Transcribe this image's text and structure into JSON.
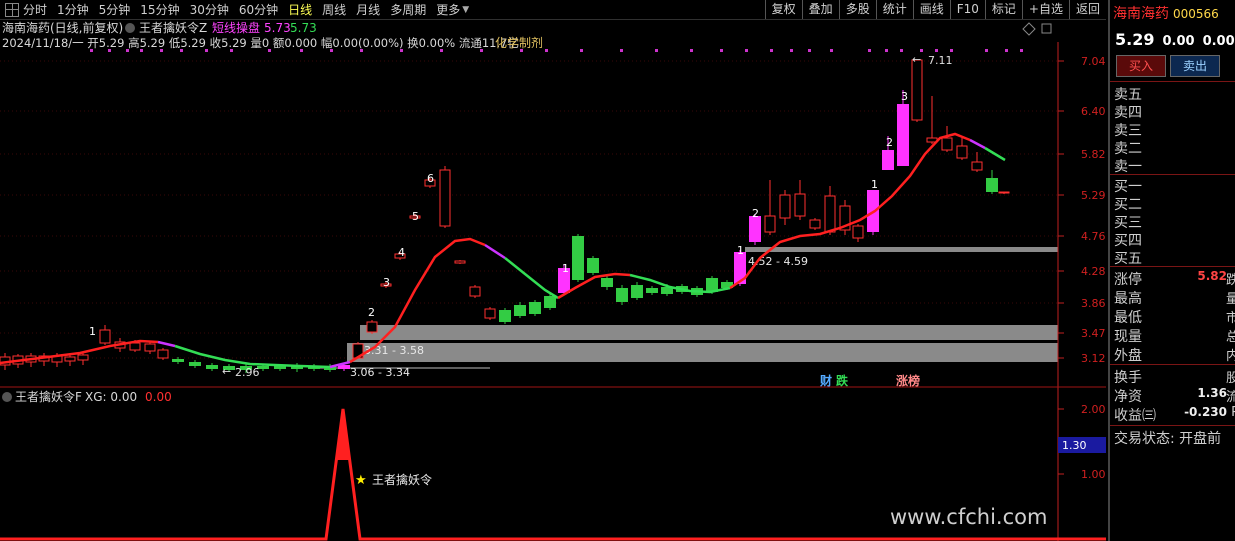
{
  "toolbar": {
    "periods": [
      "分时",
      "1分钟",
      "5分钟",
      "15分钟",
      "30分钟",
      "60分钟",
      "日线",
      "周线",
      "月线",
      "多周期",
      "更多"
    ],
    "active_period": "日线",
    "tools": [
      "复权",
      "叠加",
      "多股",
      "统计",
      "画线",
      "F10",
      "标记",
      "+自选",
      "返回"
    ]
  },
  "chart_header": {
    "stock": "海南海药(日线,前复权)",
    "indicator": "王者擒妖令Z",
    "signal_name": "短线操盘",
    "signal_v1": "5.73",
    "signal_v2": "5.73",
    "quote": "2024/11/18/一 开5.29 高5.29 低5.29 收5.29 量0 额0.000 幅0.00(0.00%) 换0.00% 流通11.7亿",
    "sector": "化学制剂"
  },
  "price_axis": [
    "7.04",
    "6.40",
    "5.82",
    "5.29",
    "4.76",
    "4.28",
    "3.86",
    "3.47",
    "3.12"
  ],
  "zones": [
    {
      "label": "4.52 - 4.59"
    },
    {
      "label": "3.31 - 3.58"
    },
    {
      "label": "3.06 - 3.34"
    }
  ],
  "price_annotations": {
    "high": "7.11",
    "low": "2.96"
  },
  "event_tags": {
    "finance": "财",
    "fall": "跌",
    "surge": "涨榜"
  },
  "sub_chart": {
    "title": "王者擒妖令F",
    "xg_label": "XG: 0.00",
    "xg_value": "0.00",
    "axis": [
      "2.00",
      "1.00"
    ],
    "cursor_value": "1.30",
    "signal_label": "王者擒妖令"
  },
  "colors": {
    "up": "#ff3030",
    "down": "#33cc44",
    "signal_bar": "#ff33ff",
    "ma_up": "#ff2020",
    "ma_down": "#33dd55",
    "ma_turn": "#cc33ff",
    "zone": "#8a8a8a",
    "axis_text": "#d02020"
  },
  "right_panel": {
    "name": "海南海药",
    "code": "000566",
    "price": "5.29",
    "change": "0.00",
    "change_pct": "0.00%",
    "buy_btn": "买入",
    "sell_btn": "卖出",
    "sell_levels": [
      "卖五",
      "卖四",
      "卖三",
      "卖二",
      "卖一"
    ],
    "buy_levels": [
      "买一",
      "买二",
      "买三",
      "买四",
      "买五"
    ],
    "limit_up_label": "涨停",
    "limit_up_value": "5.82",
    "limit_up_tail": "跌",
    "high_label": "最高",
    "high_tail": "量",
    "low_label": "最低",
    "low_tail": "市",
    "now_label": "现量",
    "now_tail": "总",
    "outer_label": "外盘",
    "outer_tail": "内",
    "turnover_label": "换手",
    "turnover_tail": "股",
    "netasset_label": "净资",
    "netasset_value": "1.36",
    "netasset_tail": "流",
    "eps_label": "收益㈢",
    "eps_value": "-0.230",
    "eps_tail": "P",
    "status": "交易状态: 开盘前"
  },
  "watermark": "www.cfchi.com"
}
